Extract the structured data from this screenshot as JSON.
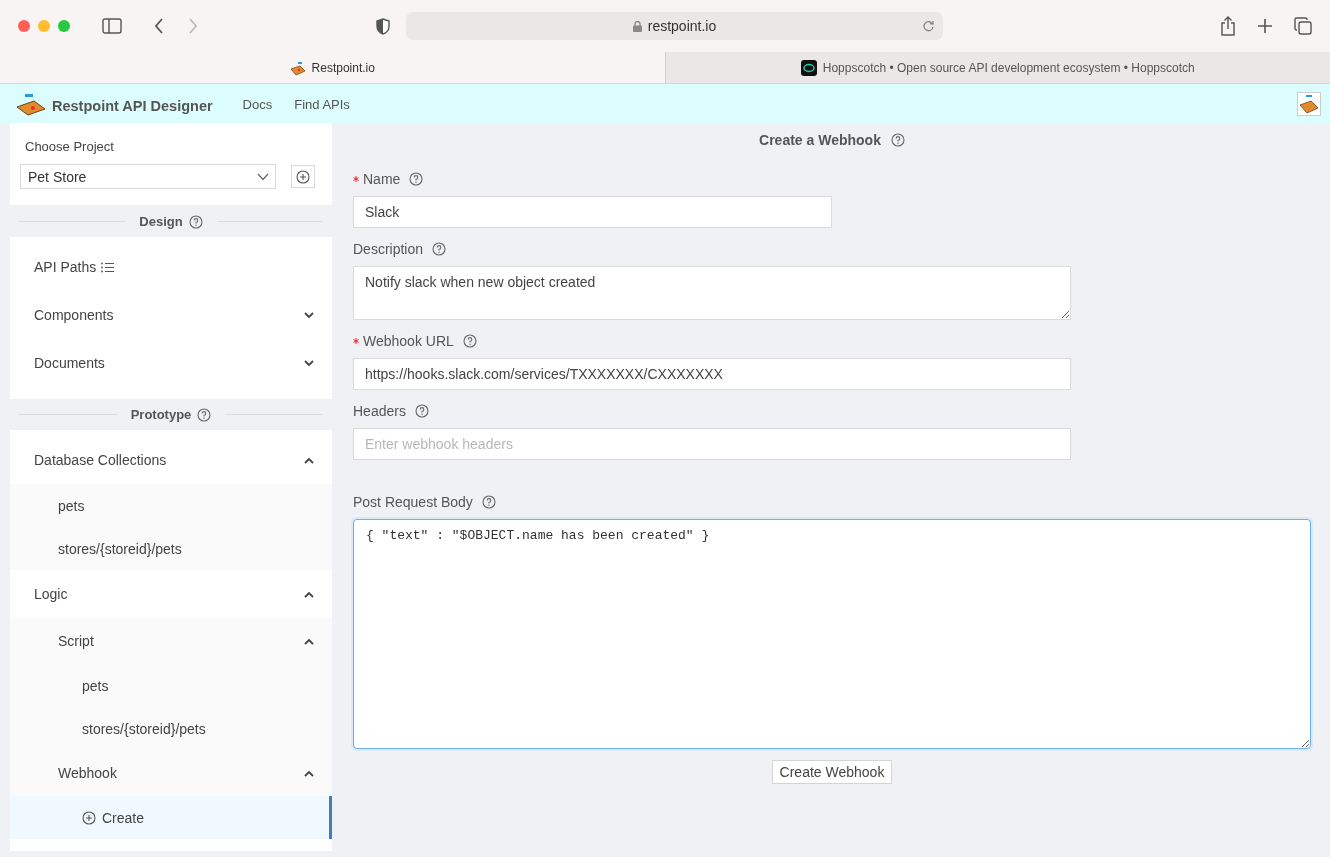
{
  "browser": {
    "address": "restpoint.io",
    "tabs": [
      {
        "title": "Restpoint.io",
        "selected": true
      },
      {
        "title": "Hoppscotch • Open source API development ecosystem • Hoppscotch",
        "selected": false
      }
    ]
  },
  "app_header": {
    "title": "Restpoint API Designer",
    "nav": [
      "Docs",
      "Find APIs"
    ]
  },
  "sidebar": {
    "project_label": "Choose Project",
    "project": "Pet Store",
    "sections": [
      {
        "title": "Design",
        "items": [
          {
            "label": "API Paths",
            "kind": "paths"
          },
          {
            "label": "Components",
            "kind": "group",
            "expanded": false
          },
          {
            "label": "Documents",
            "kind": "group",
            "expanded": false
          }
        ]
      },
      {
        "title": "Prototype",
        "items": [
          {
            "label": "Database Collections",
            "kind": "group",
            "expanded": true,
            "children": [
              {
                "label": "pets",
                "kind": "leaf",
                "selected": false
              },
              {
                "label": "stores/{storeid}/pets",
                "kind": "leaf",
                "selected": false
              }
            ]
          },
          {
            "label": "Logic",
            "kind": "group",
            "expanded": true,
            "children": [
              {
                "label": "Script",
                "kind": "group",
                "expanded": true,
                "children": [
                  {
                    "label": "pets",
                    "kind": "leaf",
                    "selected": false
                  },
                  {
                    "label": "stores/{storeid}/pets",
                    "kind": "leaf",
                    "selected": false
                  }
                ]
              },
              {
                "label": "Webhook",
                "kind": "group",
                "expanded": true,
                "children": [
                  {
                    "label": "Create",
                    "kind": "action",
                    "selected": true
                  }
                ]
              }
            ]
          }
        ]
      }
    ]
  },
  "form": {
    "title": "Create a Webhook",
    "fields": [
      {
        "label": "Name",
        "required": true,
        "kind": "short",
        "value": "Slack"
      },
      {
        "label": "Description",
        "required": false,
        "kind": "textarea",
        "value": "Notify slack when new object created"
      },
      {
        "label": "Webhook URL",
        "required": true,
        "kind": "input",
        "value": "https://hooks.slack.com/services/TXXXXXXX/CXXXXXXX"
      },
      {
        "label": "Headers",
        "required": false,
        "kind": "input",
        "placeholder": "Enter webhook headers"
      },
      {
        "label": "Post Request Body",
        "required": false,
        "kind": "code",
        "value": "{ \"text\" : \"$OBJECT.name has been created\" }"
      }
    ],
    "submit": "Create Webhook"
  }
}
